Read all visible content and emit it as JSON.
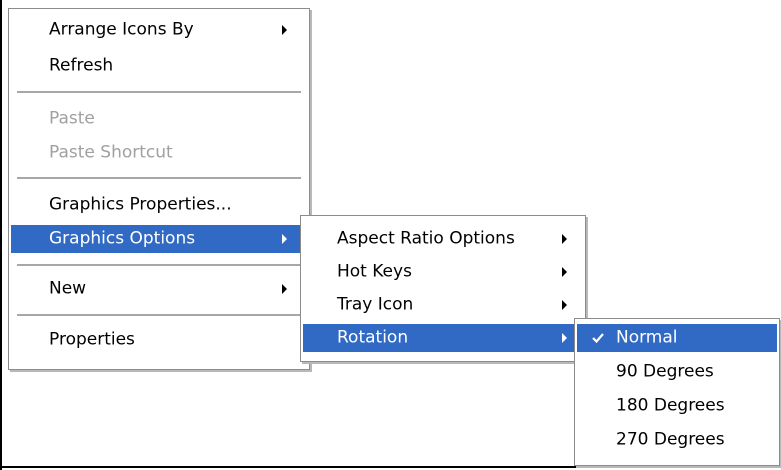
{
  "main_menu": {
    "items": [
      {
        "label": "Arrange Icons By",
        "submenu": true,
        "enabled": true
      },
      {
        "label": "Refresh",
        "submenu": false,
        "enabled": true
      },
      {
        "label": "Paste",
        "submenu": false,
        "enabled": false
      },
      {
        "label": "Paste Shortcut",
        "submenu": false,
        "enabled": false
      },
      {
        "label": "Graphics Properties...",
        "submenu": false,
        "enabled": true
      },
      {
        "label": "Graphics Options",
        "submenu": true,
        "enabled": true,
        "highlighted": true
      },
      {
        "label": "New",
        "submenu": true,
        "enabled": true
      },
      {
        "label": "Properties",
        "submenu": false,
        "enabled": true
      }
    ]
  },
  "graphics_options_menu": {
    "items": [
      {
        "label": "Aspect Ratio Options",
        "submenu": true
      },
      {
        "label": "Hot Keys",
        "submenu": true
      },
      {
        "label": "Tray Icon",
        "submenu": true
      },
      {
        "label": "Rotation",
        "submenu": true,
        "highlighted": true
      }
    ]
  },
  "rotation_menu": {
    "items": [
      {
        "label": "Normal",
        "checked": true,
        "highlighted": true
      },
      {
        "label": "90 Degrees",
        "checked": false
      },
      {
        "label": "180 Degrees",
        "checked": false
      },
      {
        "label": "270 Degrees",
        "checked": false
      }
    ]
  },
  "colors": {
    "highlight": "#316ac5",
    "disabled_text": "#a0a0a0",
    "menu_background": "#ffffff",
    "separator": "#a7a7a7"
  },
  "icons": {
    "submenu_arrow": "chevron-right-icon",
    "checkmark": "check-icon"
  }
}
